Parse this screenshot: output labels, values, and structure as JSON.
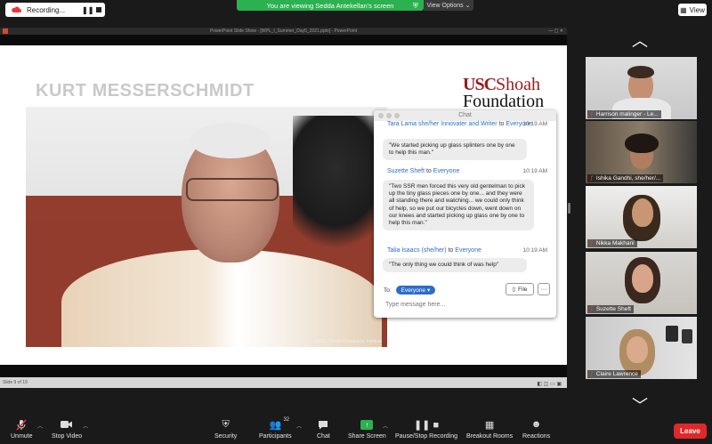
{
  "top": {
    "recording_label": "Recording...",
    "share_banner": "You are viewing Sedda Antekellan's screen",
    "view_options": "View Options ⌄",
    "view_button": "View"
  },
  "ppt": {
    "window_title": "PowerPoint Slide Show - [WPL_I_Summer_Day5_2021.pptx] - PowerPoint",
    "slide_title": "KURT MESSERSCHMIDT",
    "logo_usc": "USC",
    "logo_shoah": "Shoah",
    "logo_foundation": "Foundation",
    "video_caption": "©USC Shoah Foundation Institute",
    "slide_number": "Slide 9 of 19"
  },
  "chat": {
    "title": "Chat",
    "messages": [
      {
        "sender": "Tara Lama she/her Innovater and Writer",
        "to_word": "to",
        "to": "Everyone",
        "time": "10:19 AM",
        "text": "\"We started picking up glass splinters one by one to help this man.\""
      },
      {
        "sender": "Suzette Sheft",
        "to_word": "to",
        "to": "Everyone",
        "time": "10:19 AM",
        "text": "\"Two SSR men forced this very old gentelman to pick up the tiny glass pieces one by one... and they were all standing there and watching... we could only think of help, so we put our bicycles down, went down on our knees and started picking up glass one by one to help this man.\""
      },
      {
        "sender": "Talia Isaacs (she/her)",
        "to_word": "to",
        "to": "Everyone",
        "time": "10:19 AM",
        "text": "\"The only thing we could think of was help\""
      }
    ],
    "to_label": "To:",
    "recipient": "Everyone ▾",
    "file_label": "File",
    "more_label": "···",
    "input_placeholder": "Type message here..."
  },
  "participants": [
    {
      "name": "Harrison malinger",
      "suffix": "- Le..."
    },
    {
      "name": "Ishika Gandhi, she/her/...",
      "suffix": ""
    },
    {
      "name": "Nikka Makhani",
      "suffix": ""
    },
    {
      "name": "Suzette Sheft",
      "suffix": ""
    },
    {
      "name": "Claire Lawrence",
      "suffix": ""
    }
  ],
  "toolbar": {
    "unmute": "Unmute",
    "stop_video": "Stop Video",
    "security": "Security",
    "participants": "Participants",
    "participants_count": "32",
    "chat": "Chat",
    "share_screen": "Share Screen",
    "pause_stop_recording": "Pause/Stop Recording",
    "breakout_rooms": "Breakout Rooms",
    "reactions": "Reactions",
    "end": "Leave"
  },
  "colors": {
    "share_green": "#2bb150",
    "leave_red": "#e02828",
    "usc_cardinal": "#9a1b1f",
    "chat_link_blue": "#2d6ccb"
  }
}
